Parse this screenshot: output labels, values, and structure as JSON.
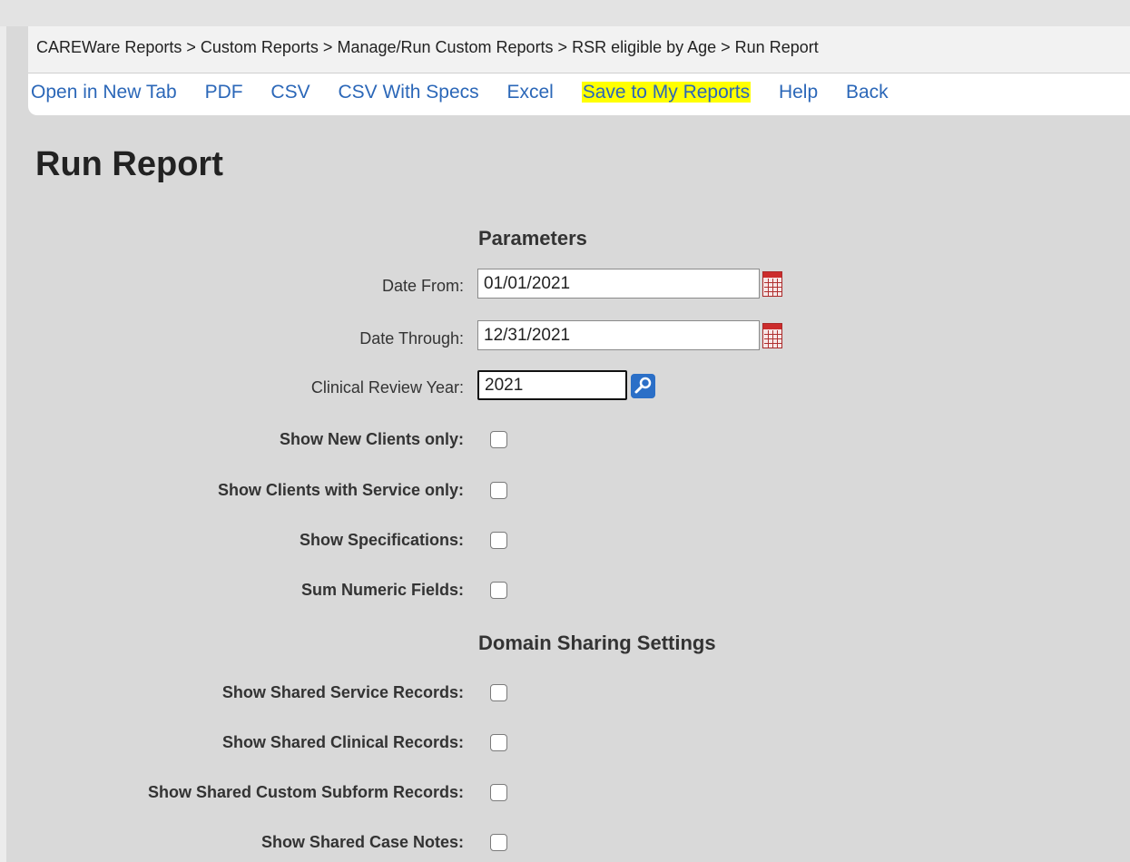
{
  "breadcrumb": "CAREWare Reports > Custom Reports > Manage/Run Custom Reports > RSR eligible by Age > Run Report",
  "toolbar": {
    "open_new_tab": "Open in New Tab",
    "pdf": "PDF",
    "csv": "CSV",
    "csv_specs": "CSV With Specs",
    "excel": "Excel",
    "save_reports": "Save to My Reports",
    "help": "Help",
    "back": "Back"
  },
  "page_title": "Run Report",
  "parameters": {
    "heading": "Parameters",
    "date_from_label": "Date From:",
    "date_from_value": "01/01/2021",
    "date_through_label": "Date Through:",
    "date_through_value": "12/31/2021",
    "clinical_year_label": "Clinical Review Year:",
    "clinical_year_value": "2021",
    "new_clients_label": "Show New Clients only:",
    "clients_service_label": "Show Clients with Service only:",
    "specifications_label": "Show Specifications:",
    "sum_numeric_label": "Sum Numeric Fields:"
  },
  "domain_sharing": {
    "heading": "Domain Sharing Settings",
    "service_records_label": "Show Shared Service Records:",
    "clinical_records_label": "Show Shared Clinical Records:",
    "subform_records_label": "Show Shared Custom Subform Records:",
    "case_notes_label": "Show Shared Case Notes:"
  },
  "icons": {
    "calendar": "calendar-icon",
    "lookup": "magnifier-icon"
  },
  "colors": {
    "link": "#2b67b8",
    "highlight": "#ffff00",
    "lookup_button": "#2b6fc7",
    "calendar": "#cc2c2c"
  }
}
